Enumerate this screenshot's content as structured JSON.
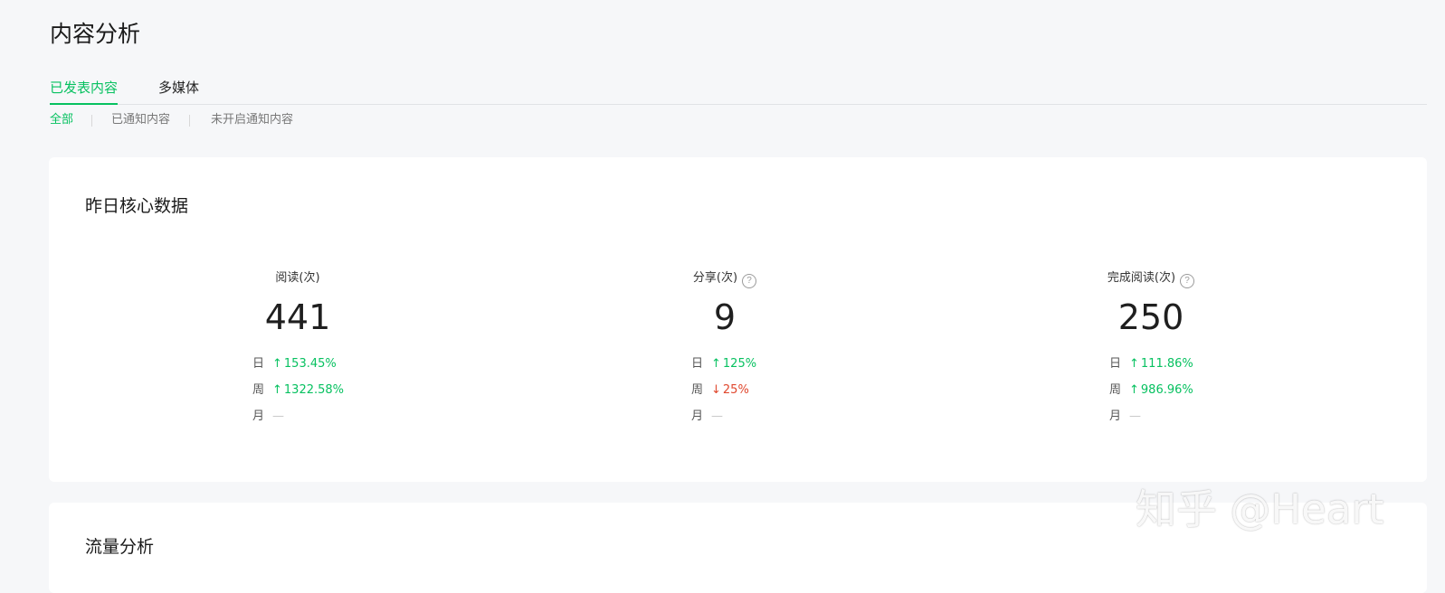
{
  "page_title": "内容分析",
  "tabs": [
    {
      "label": "已发表内容",
      "active": true
    },
    {
      "label": "多媒体",
      "active": false
    }
  ],
  "subtabs": [
    {
      "label": "全部",
      "active": true
    },
    {
      "label": "已通知内容",
      "active": false
    },
    {
      "label": "未开启通知内容",
      "active": false
    }
  ],
  "core_data": {
    "title": "昨日核心数据",
    "metrics": [
      {
        "label": "阅读(次)",
        "has_help": false,
        "value": "441",
        "rows": [
          {
            "label": "日",
            "direction": "up",
            "arrow": "↑",
            "value": "153.45%"
          },
          {
            "label": "周",
            "direction": "up",
            "arrow": "↑",
            "value": "1322.58%"
          },
          {
            "label": "月",
            "direction": "none",
            "arrow": "",
            "value": "—"
          }
        ]
      },
      {
        "label": "分享(次)",
        "has_help": true,
        "value": "9",
        "rows": [
          {
            "label": "日",
            "direction": "up",
            "arrow": "↑",
            "value": "125%"
          },
          {
            "label": "周",
            "direction": "down",
            "arrow": "↓",
            "value": "25%"
          },
          {
            "label": "月",
            "direction": "none",
            "arrow": "",
            "value": "—"
          }
        ]
      },
      {
        "label": "完成阅读(次)",
        "has_help": true,
        "value": "250",
        "rows": [
          {
            "label": "日",
            "direction": "up",
            "arrow": "↑",
            "value": "111.86%"
          },
          {
            "label": "周",
            "direction": "up",
            "arrow": "↑",
            "value": "986.96%"
          },
          {
            "label": "月",
            "direction": "none",
            "arrow": "",
            "value": "—"
          }
        ]
      }
    ]
  },
  "traffic": {
    "title": "流量分析"
  },
  "help_glyph": "?",
  "watermark": "知乎 @Heart",
  "colors": {
    "accent": "#07c160",
    "down": "#e0472d",
    "background": "#f6f7f9"
  }
}
